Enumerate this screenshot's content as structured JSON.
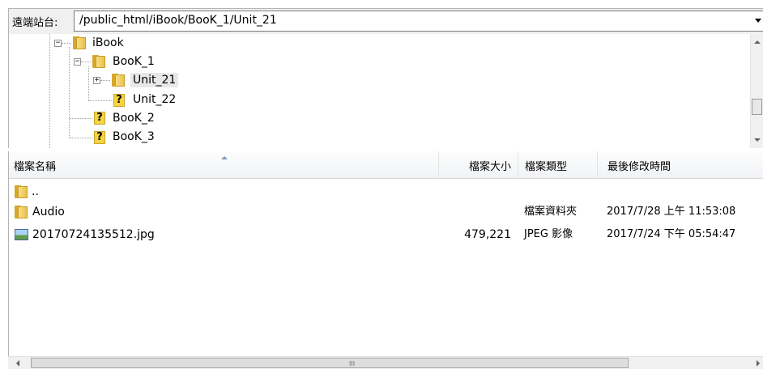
{
  "path_bar": {
    "label": "遠端站台:",
    "value": "/public_html/iBook/BooK_1/Unit_21"
  },
  "tree": {
    "items": [
      {
        "label": "iBook",
        "icon": "folder-icon",
        "expander": "−"
      },
      {
        "label": "BooK_1",
        "icon": "folder-icon",
        "expander": "−"
      },
      {
        "label": "Unit_21",
        "icon": "folder-icon",
        "expander": "+",
        "selected": true
      },
      {
        "label": "Unit_22",
        "icon": "unknown-folder-icon"
      },
      {
        "label": "BooK_2",
        "icon": "unknown-folder-icon"
      },
      {
        "label": "BooK_3",
        "icon": "unknown-folder-icon"
      }
    ],
    "unknown_glyph": "?"
  },
  "list": {
    "columns": {
      "name": "檔案名稱",
      "size": "檔案大小",
      "type": "檔案類型",
      "modified": "最後修改時間"
    },
    "rows": [
      {
        "name": "..",
        "size": "",
        "type": "",
        "modified": "",
        "icon": "folder-icon"
      },
      {
        "name": "Audio",
        "size": "",
        "type": "檔案資料夾",
        "modified": "2017/7/28 上午 11:53:08",
        "icon": "folder-icon"
      },
      {
        "name": "20170724135512.jpg",
        "size": "479,221",
        "type": "JPEG 影像",
        "modified": "2017/7/24 下午 05:54:47",
        "icon": "image-file-icon"
      }
    ]
  },
  "scrollbar": {
    "grip": "III"
  }
}
